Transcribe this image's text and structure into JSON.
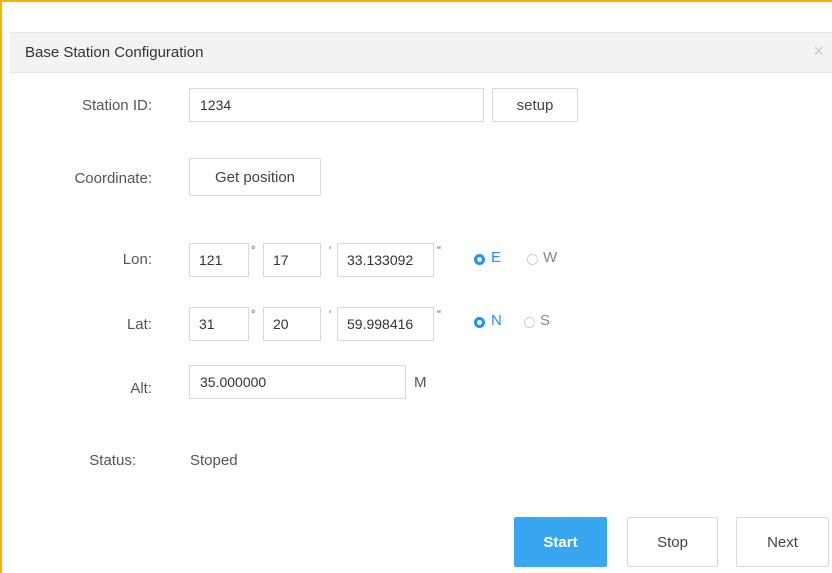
{
  "dialog": {
    "title": "Base Station Configuration",
    "close_icon": "×"
  },
  "station": {
    "label": "Station ID:",
    "value": "1234",
    "setup_label": "setup"
  },
  "coordinate": {
    "label": "Coordinate:",
    "get_position_label": "Get position"
  },
  "lon": {
    "label": "Lon:",
    "deg": "121",
    "min": "17",
    "sec": "33.133092",
    "deg_symbol": "°",
    "min_symbol": "'",
    "sec_symbol": "\"",
    "option_a": "E",
    "option_b": "W",
    "selected": "E"
  },
  "lat": {
    "label": "Lat:",
    "deg": "31",
    "min": "20",
    "sec": "59.998416",
    "deg_symbol": "°",
    "min_symbol": "'",
    "sec_symbol": "\"",
    "option_a": "N",
    "option_b": "S",
    "selected": "N"
  },
  "alt": {
    "label": "Alt:",
    "value": "35.000000",
    "unit": "M"
  },
  "status": {
    "label": "Status:",
    "value": "Stoped"
  },
  "actions": {
    "start_label": "Start",
    "stop_label": "Stop",
    "next_label": "Next"
  },
  "colors": {
    "frame_border": "#f5b400",
    "primary": "#38a6f1",
    "radio_active": "#1e90ff"
  }
}
